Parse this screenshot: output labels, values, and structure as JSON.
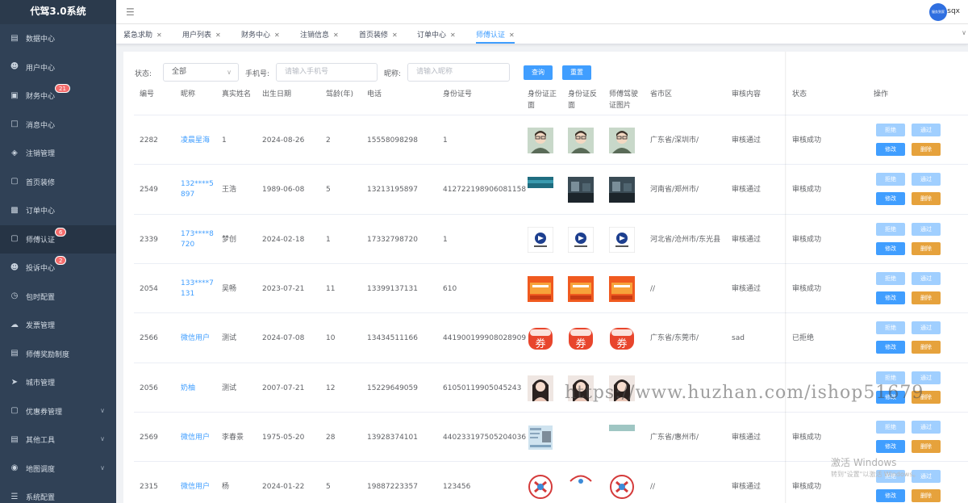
{
  "app": {
    "title": "代驾3.0系统"
  },
  "header": {
    "user_name": "sqx",
    "avatar_text": "服务到家"
  },
  "sidebar": {
    "items": [
      {
        "label": "数据中心",
        "icon": "chart-icon"
      },
      {
        "label": "用户中心",
        "icon": "user-icon"
      },
      {
        "label": "财务中心",
        "icon": "wallet-icon",
        "badge": "21"
      },
      {
        "label": "消息中心",
        "icon": "message-icon"
      },
      {
        "label": "注销管理",
        "icon": "layers-icon"
      },
      {
        "label": "首页装修",
        "icon": "cube-icon"
      },
      {
        "label": "订单中心",
        "icon": "order-icon"
      },
      {
        "label": "师傅认证",
        "icon": "cube-icon",
        "badge": "6"
      },
      {
        "label": "投诉中心",
        "icon": "user-icon",
        "badge": "2"
      },
      {
        "label": "包时配置",
        "icon": "clock-icon"
      },
      {
        "label": "发票管理",
        "icon": "cloud-icon"
      },
      {
        "label": "师傅奖励制度",
        "icon": "document-icon"
      },
      {
        "label": "城市管理",
        "icon": "send-icon"
      },
      {
        "label": "优惠券管理",
        "icon": "cube-icon"
      },
      {
        "label": "其他工具",
        "icon": "tool-icon"
      },
      {
        "label": "地图调度",
        "icon": "location-icon"
      },
      {
        "label": "系统配置",
        "icon": "list-icon"
      }
    ]
  },
  "tabs": [
    {
      "label": "紧急求助"
    },
    {
      "label": "用户列表"
    },
    {
      "label": "财务中心"
    },
    {
      "label": "注销信息"
    },
    {
      "label": "首页装修"
    },
    {
      "label": "订单中心"
    },
    {
      "label": "师傅认证",
      "active": true
    }
  ],
  "filter": {
    "status_label": "状态:",
    "status_value": "全部",
    "phone_label": "手机号:",
    "phone_placeholder": "请输入手机号",
    "nick_label": "昵称:",
    "nick_placeholder": "请输入昵称",
    "search_btn": "查询",
    "reset_btn": "重置"
  },
  "table": {
    "headers": {
      "id": "编号",
      "nick": "昵称",
      "name": "真实姓名",
      "birth": "出生日期",
      "years": "驾龄(年)",
      "phone": "电话",
      "idcard": "身份证号",
      "front": "身份证正面",
      "back": "身份证反面",
      "license": "师傅驾驶证图片",
      "region": "省市区",
      "review": "审核内容",
      "status": "状态",
      "ops": "操作"
    },
    "ops": {
      "reject": "拒绝",
      "pass": "通过",
      "edit": "修改",
      "delete": "删除"
    },
    "rows": [
      {
        "id": "2282",
        "nick": "凌晨星海",
        "name": "1",
        "birth": "2024-08-26",
        "years": "2",
        "phone": "15558098298",
        "idcard": "1",
        "region": "广东省/深圳市/",
        "review": "审核通过",
        "status": "审核成功",
        "img": "avatar"
      },
      {
        "id": "2549",
        "nick": "132****5897",
        "name": "王浩",
        "birth": "1989-06-08",
        "years": "5",
        "phone": "13213195897",
        "idcard": "412722198906081158",
        "region": "河南省/郑州市/",
        "review": "审核通过",
        "status": "审核成功",
        "img": "photo"
      },
      {
        "id": "2339",
        "nick": "173****8720",
        "name": "梦创",
        "birth": "2024-02-18",
        "years": "1",
        "phone": "17332798720",
        "idcard": "1",
        "region": "河北省/沧州市/东光县",
        "review": "审核通过",
        "status": "审核成功",
        "img": "logo"
      },
      {
        "id": "2054",
        "nick": "133****7131",
        "name": "吴畅",
        "birth": "2023-07-21",
        "years": "11",
        "phone": "13399137131",
        "idcard": "610",
        "region": "//",
        "review": "审核通过",
        "status": "审核成功",
        "img": "coupon"
      },
      {
        "id": "2566",
        "nick": "微信用户",
        "name": "测试",
        "birth": "2024-07-08",
        "years": "10",
        "phone": "13434511166",
        "idcard": "441900199908028909",
        "region": "广东省/东莞市/",
        "review": "sad",
        "status": "已拒绝",
        "img": "quan",
        "quan_char": "券"
      },
      {
        "id": "2056",
        "nick": "奶柚",
        "name": "测试",
        "birth": "2007-07-21",
        "years": "12",
        "phone": "15229649059",
        "idcard": "61050119905045243",
        "region": "",
        "review": "",
        "status": "",
        "img": "girl"
      },
      {
        "id": "2569",
        "nick": "微信用户",
        "name": "李春景",
        "birth": "1975-05-20",
        "years": "28",
        "phone": "13928374101",
        "idcard": "440233197505204036",
        "region": "广东省/惠州市/",
        "review": "审核通过",
        "status": "审核成功",
        "img": "card"
      },
      {
        "id": "2315",
        "nick": "微信用户",
        "name": "杨",
        "birth": "2024-01-22",
        "years": "5",
        "phone": "19887223357",
        "idcard": "123456",
        "region": "//",
        "review": "审核通过",
        "status": "审核成功",
        "img": "round"
      }
    ]
  },
  "overlay": {
    "watermark": "https://www.huzhan.com/ishop51679",
    "activate_title": "激活 Windows",
    "activate_sub": "转到\"设置\"以激活 Windows。"
  }
}
